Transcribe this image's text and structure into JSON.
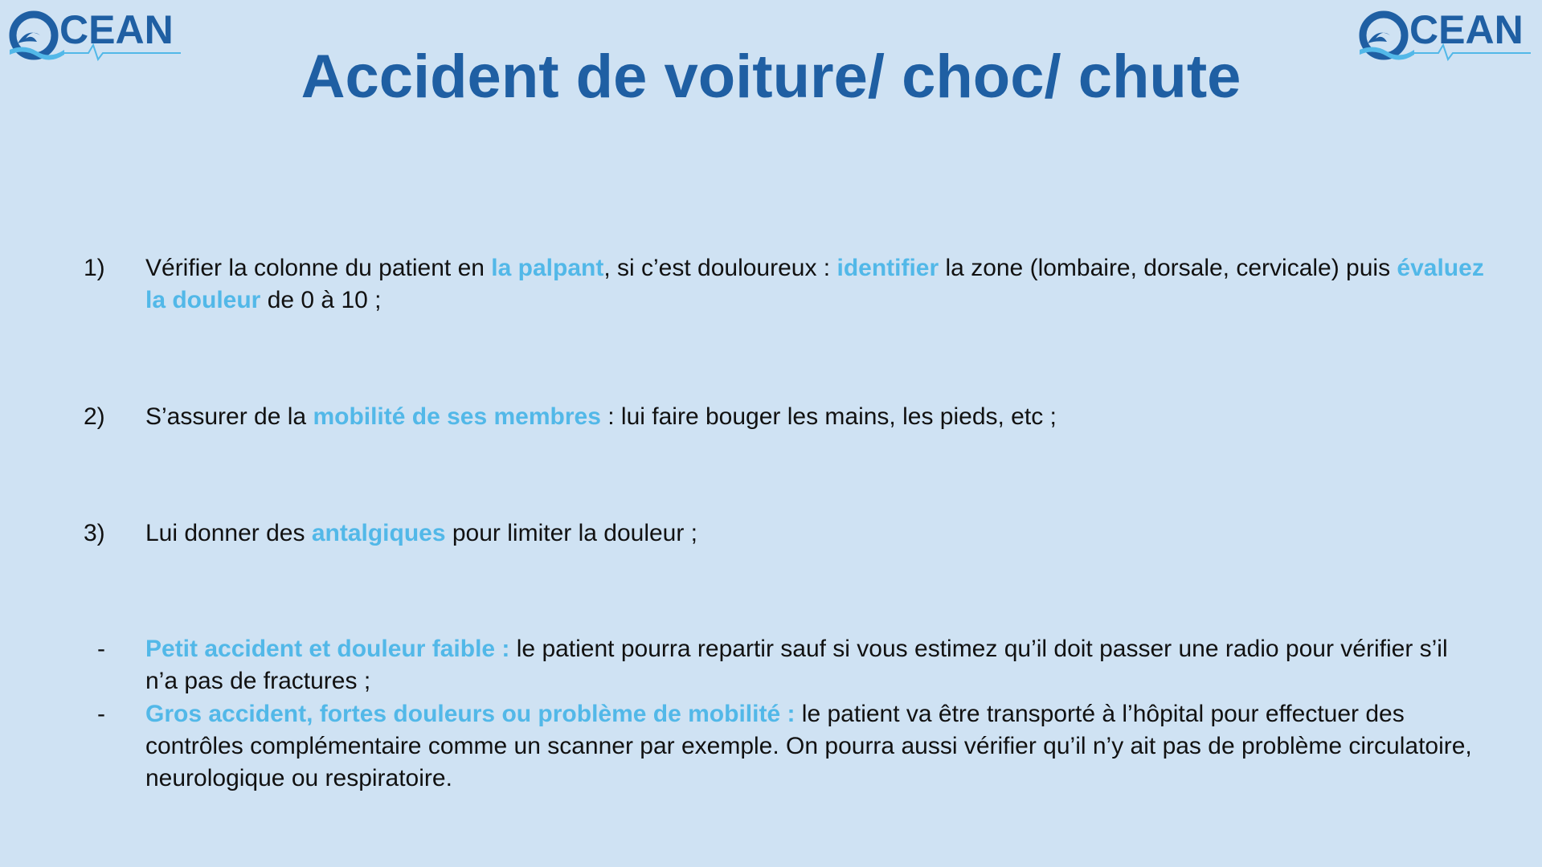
{
  "logo": {
    "text": "CEAN"
  },
  "title": "Accident de voiture/ choc/ chute",
  "colors": {
    "background": "#cfe2f3",
    "title": "#1f5fa3",
    "highlight": "#52b8e8",
    "body_text": "#111111"
  },
  "items": [
    {
      "marker": "1)",
      "parts": [
        {
          "t": "Vérifier la colonne du patient en "
        },
        {
          "t": "la palpant",
          "hl": true
        },
        {
          "t": ", si c’est douloureux : "
        },
        {
          "t": "identifier",
          "hl": true
        },
        {
          "t": " la zone (lombaire, dorsale, cervicale) puis "
        },
        {
          "t": "évaluez la douleur",
          "hl": true
        },
        {
          "t": " de 0 à 10 ;"
        }
      ]
    },
    {
      "marker": "2)",
      "parts": [
        {
          "t": "S’assurer de la "
        },
        {
          "t": "mobilité de ses membres",
          "hl": true
        },
        {
          "t": " : lui faire bouger les mains, les pieds, etc ;"
        }
      ]
    },
    {
      "marker": "3)",
      "parts": [
        {
          "t": "Lui donner des "
        },
        {
          "t": "antalgiques",
          "hl": true
        },
        {
          "t": " pour limiter la douleur ;"
        }
      ]
    },
    {
      "marker": "-",
      "parts": [
        {
          "t": "Petit accident et douleur faible :",
          "hl": true
        },
        {
          "t": " le patient pourra repartir sauf si vous estimez qu’il doit passer une radio pour vérifier s’il n’a pas de fractures ;"
        }
      ]
    },
    {
      "marker": "-",
      "parts": [
        {
          "t": "Gros accident, fortes douleurs ou problème de mobilité :",
          "hl": true
        },
        {
          "t": " le patient va être transporté à l’hôpital pour effectuer des contrôles complémentaire comme un scanner par exemple. On pourra aussi vérifier qu’il n’y ait pas de problème circulatoire, neurologique ou respiratoire."
        }
      ]
    }
  ]
}
